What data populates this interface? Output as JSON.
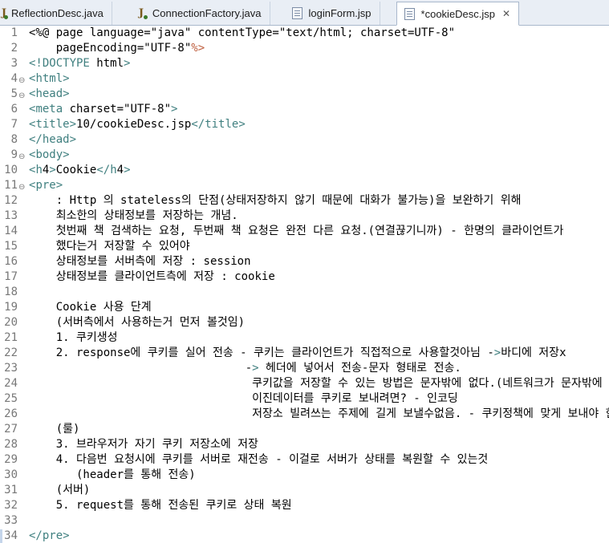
{
  "tabs": [
    {
      "label": "ReflectionDesc.java",
      "icon": "java-file-icon"
    },
    {
      "label": "ConnectionFactory.java",
      "icon": "java-file-icon"
    },
    {
      "label": "loginForm.jsp",
      "icon": "jsp-file-icon"
    },
    {
      "label": "*cookieDesc.jsp",
      "icon": "jsp-file-icon",
      "active": true
    }
  ],
  "close_glyph": "✕",
  "colors": {
    "tag": "#3f7f7f",
    "attribute": "#7f007f",
    "string": "#2a00ff",
    "directive": "#bf5f3f",
    "line_number": "#787878"
  },
  "editor": {
    "lines": [
      {
        "n": "1",
        "text": "<%@ page language=\"java\" contentType=\"text/html; charset=UTF-8\""
      },
      {
        "n": "2",
        "text": "    pageEncoding=\"UTF-8\"%>"
      },
      {
        "n": "3",
        "text": "<!DOCTYPE html>"
      },
      {
        "n": "4",
        "text": "<html>",
        "fold": true
      },
      {
        "n": "5",
        "text": "<head>",
        "fold": true
      },
      {
        "n": "6",
        "text": "<meta charset=\"UTF-8\">"
      },
      {
        "n": "7",
        "text": "<title>10/cookieDesc.jsp</title>"
      },
      {
        "n": "8",
        "text": "</head>"
      },
      {
        "n": "9",
        "text": "<body>",
        "fold": true
      },
      {
        "n": "10",
        "text": "<h4>Cookie</h4>"
      },
      {
        "n": "11",
        "text": "<pre>",
        "fold": true
      },
      {
        "n": "12",
        "text": "    : Http 의 stateless의 단점(상태저장하지 않기 때문에 대화가 불가능)을 보완하기 위해"
      },
      {
        "n": "13",
        "text": "    최소한의 상태정보를 저장하는 개념."
      },
      {
        "n": "14",
        "text": "    첫번째 책 검색하는 요청, 두번째 책 요청은 완전 다른 요청.(연결끊기니까) - 한명의 클라이언트가"
      },
      {
        "n": "15",
        "text": "    했다는거 저장할 수 있어야"
      },
      {
        "n": "16",
        "text": "    상태정보를 서버측에 저장 : session"
      },
      {
        "n": "17",
        "text": "    상태정보를 클라이언트측에 저장 : cookie"
      },
      {
        "n": "18",
        "text": ""
      },
      {
        "n": "19",
        "text": "    Cookie 사용 단계"
      },
      {
        "n": "20",
        "text": "    (서버측에서 사용하는거 먼저 볼것임)"
      },
      {
        "n": "21",
        "text": "    1. 쿠키생성"
      },
      {
        "n": "22",
        "text": "    2. response에 쿠키를 실어 전송 - 쿠키는 클라이언트가 직접적으로 사용할것아님 ->바디에 저장x"
      },
      {
        "n": "23",
        "text": "                                -> 헤더에 넣어서 전송-문자 형태로 전송."
      },
      {
        "n": "24",
        "text": "                                 쿠키값을 저장할 수 있는 방법은 문자밖에 없다.(네트워크가 문자밖에 인지 못해서)"
      },
      {
        "n": "25",
        "text": "                                 이진데이터를 쿠키로 보내려면? - 인코딩"
      },
      {
        "n": "26",
        "text": "                                 저장소 빌려쓰는 주제에 길게 보낼수없음. - 쿠키정책에 맞게 보내야 한다."
      },
      {
        "n": "27",
        "text": "    (룰)"
      },
      {
        "n": "28",
        "text": "    3. 브라우저가 자기 쿠키 저장소에 저장"
      },
      {
        "n": "29",
        "text": "    4. 다음번 요청시에 쿠키를 서버로 재전송 - 이걸로 서버가 상태를 복원할 수 있는것"
      },
      {
        "n": "30",
        "text": "       (header를 통해 전송)"
      },
      {
        "n": "31",
        "text": "    (서버)"
      },
      {
        "n": "32",
        "text": "    5. request를 통해 전송된 쿠키로 상태 복원"
      },
      {
        "n": "33",
        "text": ""
      },
      {
        "n": "34",
        "text": "</pre>"
      }
    ]
  }
}
